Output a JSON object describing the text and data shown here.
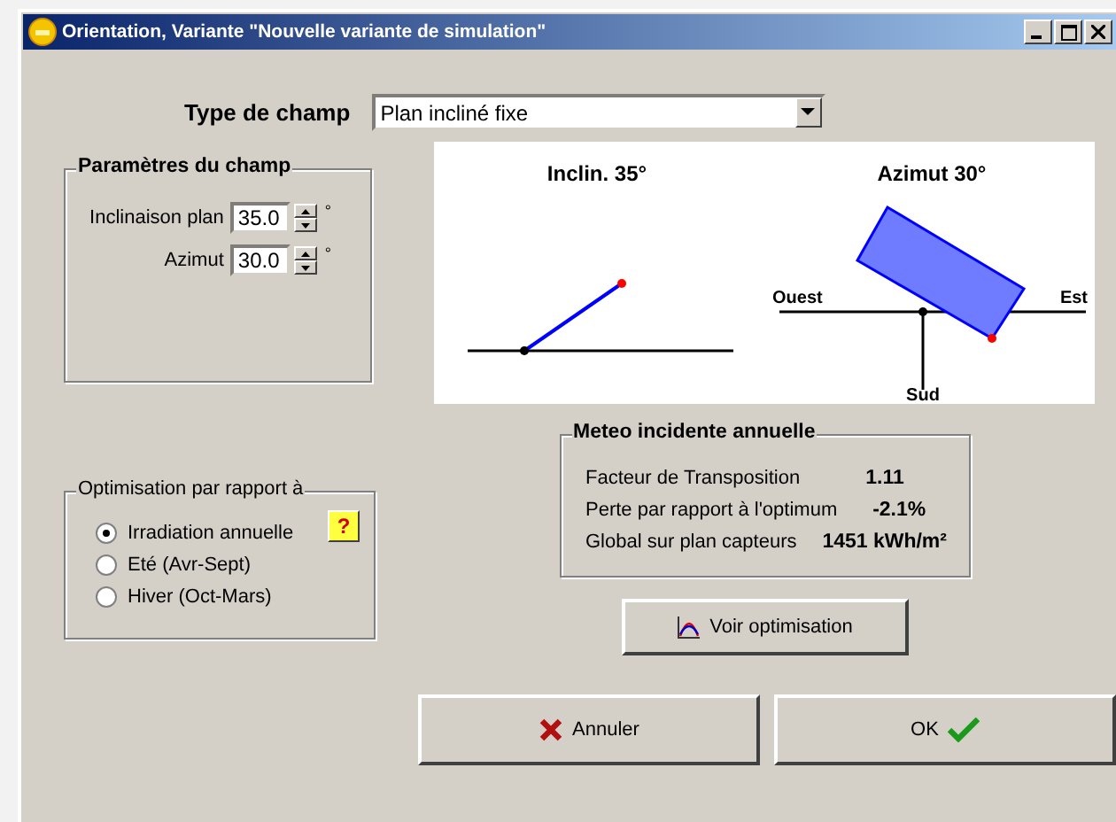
{
  "window": {
    "title": "Orientation, Variante \"Nouvelle variante de simulation\""
  },
  "field_type": {
    "label": "Type de champ",
    "value": "Plan incliné fixe"
  },
  "field_params": {
    "title": "Paramètres du champ",
    "fields": [
      {
        "label": "Inclinaison plan",
        "value": "35.0",
        "unit": "°"
      },
      {
        "label": "Azimut",
        "value": "30.0",
        "unit": "°"
      }
    ]
  },
  "diagram": {
    "tilt_title": "Inclin. 35°",
    "azimuth_title": "Azimut 30°",
    "west": "Ouest",
    "east": "Est",
    "south": "Sud"
  },
  "optimisation": {
    "title": "Optimisation par rapport à",
    "help": "?",
    "options": [
      {
        "label": "Irradiation annuelle",
        "selected": true
      },
      {
        "label": "Eté (Avr-Sept)",
        "selected": false
      },
      {
        "label": "Hiver (Oct-Mars)",
        "selected": false
      }
    ]
  },
  "meteo": {
    "title": "Meteo incidente annuelle",
    "rows": [
      {
        "label": "Facteur de Transposition",
        "value": "1.11"
      },
      {
        "label": "Perte par rapport à l'optimum",
        "value": "-2.1%"
      },
      {
        "label": "Global sur plan capteurs",
        "value": "1451 kWh/m²"
      }
    ]
  },
  "buttons": {
    "optimisation": "Voir optimisation",
    "cancel": "Annuler",
    "ok": "OK"
  }
}
